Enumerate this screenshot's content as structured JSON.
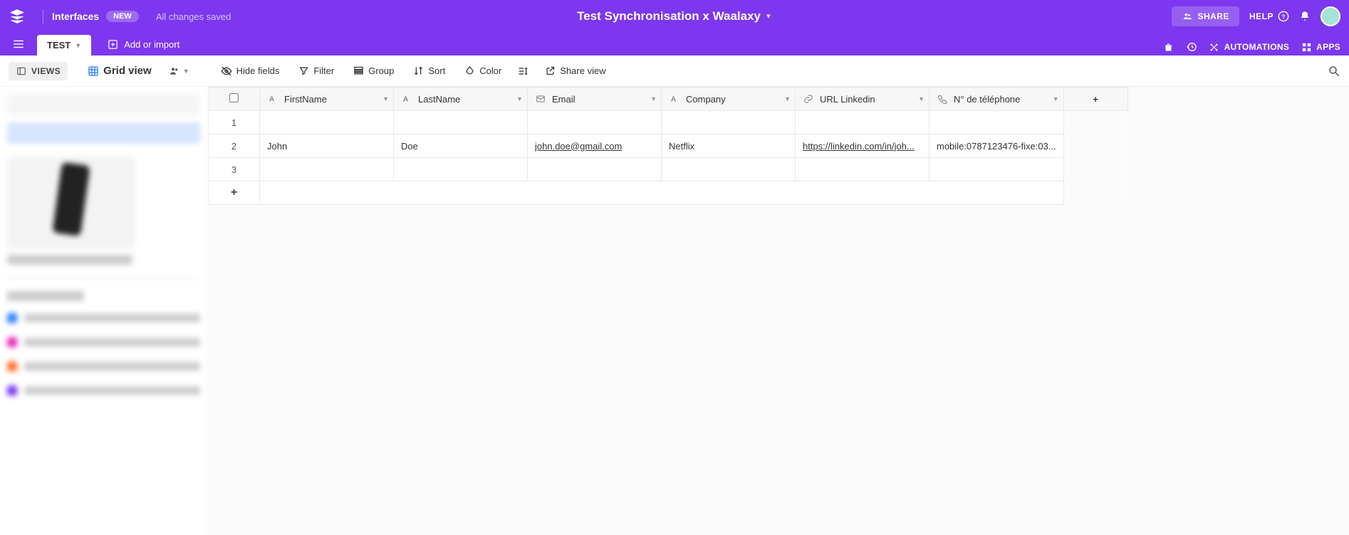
{
  "header": {
    "interfaces": "Interfaces",
    "new_badge": "NEW",
    "saved": "All changes saved",
    "base_title": "Test Synchronisation x Waalaxy",
    "share": "SHARE",
    "help": "HELP",
    "automations": "AUTOMATIONS",
    "apps": "APPS"
  },
  "tabs": {
    "active": "TEST",
    "add_import": "Add or import"
  },
  "toolbar": {
    "views": "VIEWS",
    "grid_view": "Grid view",
    "hide_fields": "Hide fields",
    "filter": "Filter",
    "group": "Group",
    "sort": "Sort",
    "color": "Color",
    "share_view": "Share view"
  },
  "columns": [
    {
      "label": "FirstName",
      "icon": "text"
    },
    {
      "label": "LastName",
      "icon": "text"
    },
    {
      "label": "Email",
      "icon": "email"
    },
    {
      "label": "Company",
      "icon": "text"
    },
    {
      "label": "URL Linkedin",
      "icon": "url"
    },
    {
      "label": "N° de téléphone",
      "icon": "phone"
    }
  ],
  "rows": [
    {
      "num": "1",
      "FirstName": "",
      "LastName": "",
      "Email": "",
      "Company": "",
      "URL": "",
      "Phone": ""
    },
    {
      "num": "2",
      "FirstName": "John",
      "LastName": "Doe",
      "Email": "john.doe@gmail.com",
      "Company": "Netflix",
      "URL": "https://linkedin.com/in/joh...",
      "Phone": "mobile:0787123476-fixe:03..."
    },
    {
      "num": "3",
      "FirstName": "",
      "LastName": "",
      "Email": "",
      "Company": "",
      "URL": "",
      "Phone": ""
    }
  ],
  "add_row": "+",
  "add_col": "+"
}
